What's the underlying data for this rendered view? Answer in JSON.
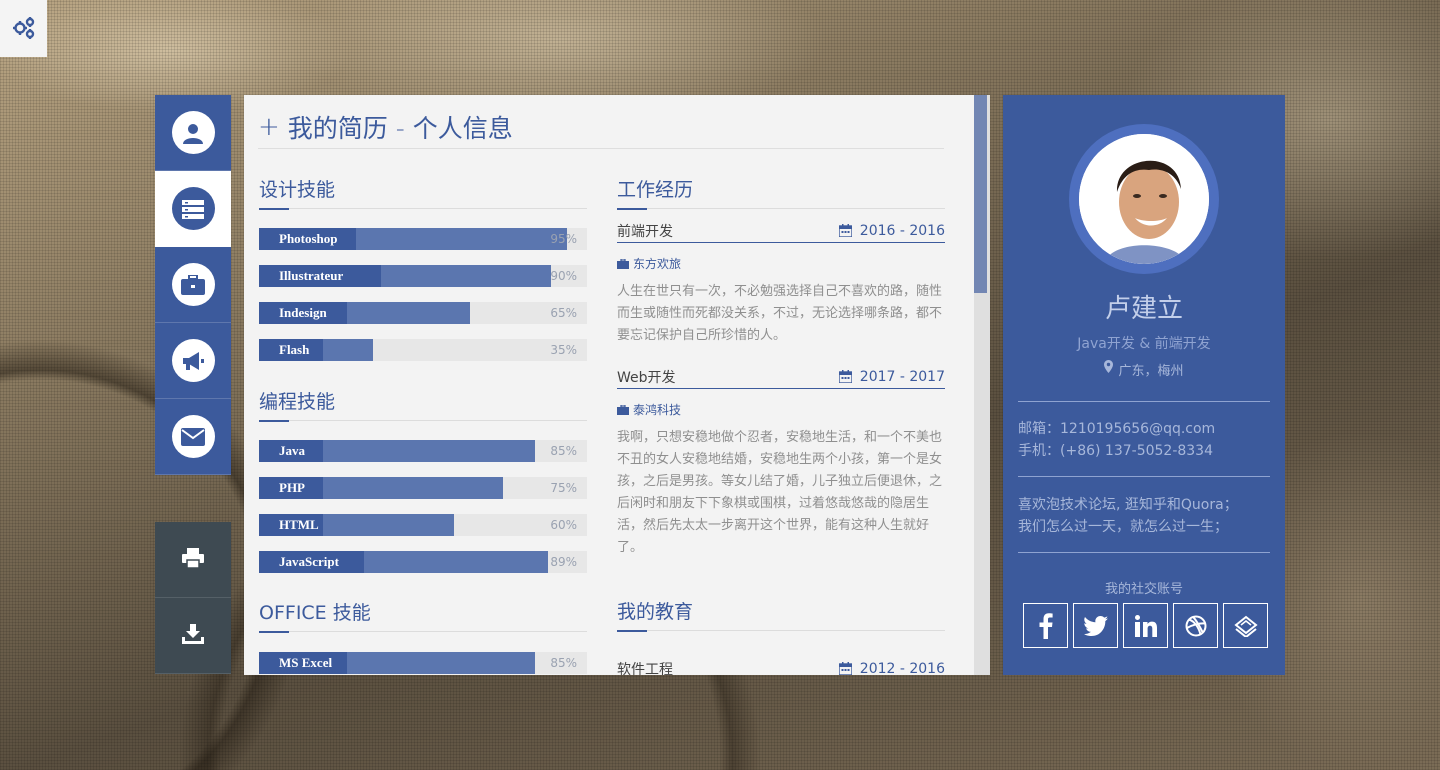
{
  "page_title": "我的简历 - 个人信息",
  "page_title_icon": "plus-icon",
  "nav": {
    "items": [
      {
        "name": "profile",
        "icon": "user-icon"
      },
      {
        "name": "resume",
        "icon": "list-icon",
        "active": true
      },
      {
        "name": "work",
        "icon": "briefcase-icon"
      },
      {
        "name": "announce",
        "icon": "megaphone-icon"
      },
      {
        "name": "contact",
        "icon": "envelope-icon"
      }
    ],
    "tools": [
      {
        "name": "print",
        "icon": "print-icon"
      },
      {
        "name": "download",
        "icon": "download-icon"
      }
    ]
  },
  "design_skills": {
    "title": "设计技能",
    "items": [
      {
        "label": "Photoshop",
        "percent": 95,
        "pct_label": "95%"
      },
      {
        "label": "Illustrateur",
        "percent": 90,
        "pct_label": "90%"
      },
      {
        "label": "Indesign",
        "percent": 65,
        "pct_label": "65%"
      },
      {
        "label": "Flash",
        "percent": 35,
        "pct_label": "35%"
      }
    ]
  },
  "programming_skills": {
    "title": "编程技能",
    "items": [
      {
        "label": "Java",
        "percent": 85,
        "pct_label": "85%"
      },
      {
        "label": "PHP",
        "percent": 75,
        "pct_label": "75%"
      },
      {
        "label": "HTML",
        "percent": 60,
        "pct_label": "60%"
      },
      {
        "label": "JavaScript",
        "percent": 89,
        "pct_label": "89%"
      }
    ]
  },
  "office_skills": {
    "title": "OFFICE 技能",
    "items": [
      {
        "label": "MS Excel",
        "percent": 85,
        "pct_label": "85%"
      }
    ]
  },
  "work": {
    "title": "工作经历",
    "jobs": [
      {
        "role": "前端开发",
        "date": "2016 - 2016",
        "company": "东方欢旅",
        "desc": "人生在世只有一次，不必勉强选择自己不喜欢的路，随性而生或随性而死都没关系，不过，无论选择哪条路，都不要忘记保护自己所珍惜的人。"
      },
      {
        "role": "Web开发",
        "date": "2017 - 2017",
        "company": "泰鸿科技",
        "desc": "我啊，只想安稳地做个忍者，安稳地生活，和一个不美也不丑的女人安稳地结婚，安稳地生两个小孩，第一个是女孩，之后是男孩。等女儿结了婚，儿子独立后便退休，之后闲时和朋友下下象棋或围棋，过着悠哉悠哉的隐居生活，然后先太太一步离开这个世界，能有这种人生就好了。"
      }
    ]
  },
  "education": {
    "title": "我的教育",
    "items": [
      {
        "major": "软件工程",
        "date": "2012 - 2016"
      }
    ]
  },
  "profile": {
    "name": "卢建立",
    "title": "Java开发 & 前端开发",
    "location": "广东，梅州",
    "email": "邮箱：1210195656@qq.com",
    "phone": "手机：(+86) 137-5052-8334",
    "bio_line1": "喜欢泡技术论坛, 逛知乎和Quora；",
    "bio_line2": "我们怎么过一天，就怎么过一生；",
    "social_title": "我的社交账号",
    "social": [
      "facebook-icon",
      "twitter-icon",
      "linkedin-icon",
      "dribbble-icon",
      "stack-icon"
    ]
  },
  "colors": {
    "primary": "#3c5a9c",
    "bar_fill": "#5b76af",
    "bar_track": "#e7e7e7",
    "panel_bg": "#f3f3f3",
    "tool_bg": "#3e4a52"
  }
}
